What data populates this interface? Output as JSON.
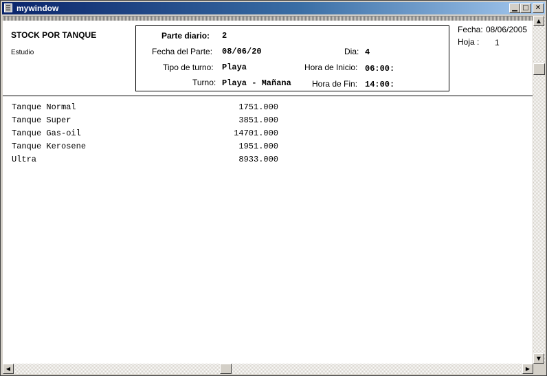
{
  "window": {
    "title": "mywindow"
  },
  "report": {
    "title": "STOCK POR TANQUE",
    "subtitle": "Estudio",
    "parte_diario_label": "Parte diario:",
    "parte_diario_value": "2",
    "fecha_parte_label": "Fecha del Parte:",
    "fecha_parte_value": "08/06/20",
    "dia_label": "Dia:",
    "dia_value": "4",
    "tipo_turno_label": "Tipo de turno:",
    "tipo_turno_value": "Playa",
    "hora_inicio_label": "Hora de Inicio:",
    "hora_inicio_value": "06:00:",
    "turno_label": "Turno:",
    "turno_value": "Playa - Mañana",
    "hora_fin_label": "Hora de Fin:",
    "hora_fin_value": "14:00:",
    "fecha_label": "Fecha:",
    "fecha_value": "08/06/2005",
    "hoja_label": "Hoja :",
    "hoja_value": "1"
  },
  "tanks": [
    {
      "name": "Tanque Normal",
      "value": "1751.000"
    },
    {
      "name": "Tanque Super",
      "value": "3851.000"
    },
    {
      "name": "Tanque Gas-oil",
      "value": "14701.000"
    },
    {
      "name": "Tanque Kerosene",
      "value": "1951.000"
    },
    {
      "name": "Ultra",
      "value": "8933.000"
    }
  ],
  "icons": {
    "minimize": "minimize-icon",
    "maximize": "maximize-icon",
    "close": "close-icon"
  }
}
